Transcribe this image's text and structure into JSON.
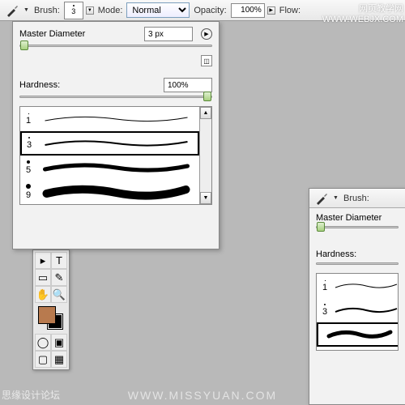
{
  "topbar": {
    "brush_label": "Brush:",
    "brush_size": "3",
    "mode_label": "Mode:",
    "mode_value": "Normal",
    "opacity_label": "Opacity:",
    "opacity_value": "100%",
    "flow_label": "Flow:"
  },
  "panel": {
    "master_diameter_label": "Master Diameter",
    "master_diameter_value": "3 px",
    "hardness_label": "Hardness:",
    "hardness_value": "100%",
    "brushes": [
      {
        "size": "1",
        "selected": false,
        "weight": 1
      },
      {
        "size": "3",
        "selected": true,
        "weight": 2
      },
      {
        "size": "5",
        "selected": false,
        "weight": 5
      },
      {
        "size": "9",
        "selected": false,
        "weight": 10
      }
    ]
  },
  "panel_right": {
    "brush_label": "Brush:",
    "master_diameter_label": "Master Diameter",
    "hardness_label": "Hardness:",
    "brushes": [
      {
        "size": "1",
        "weight": 1
      },
      {
        "size": "3",
        "weight": 2
      }
    ]
  },
  "colors": {
    "foreground": "#b87a4e",
    "background": "#000000"
  },
  "watermarks": {
    "top_right_cn": "网页教学网",
    "top_right_url": "WWW.WEBJX.COM",
    "bottom": "WWW.MISSYUAN.COM",
    "bottom_left": "思缘设计论坛"
  }
}
